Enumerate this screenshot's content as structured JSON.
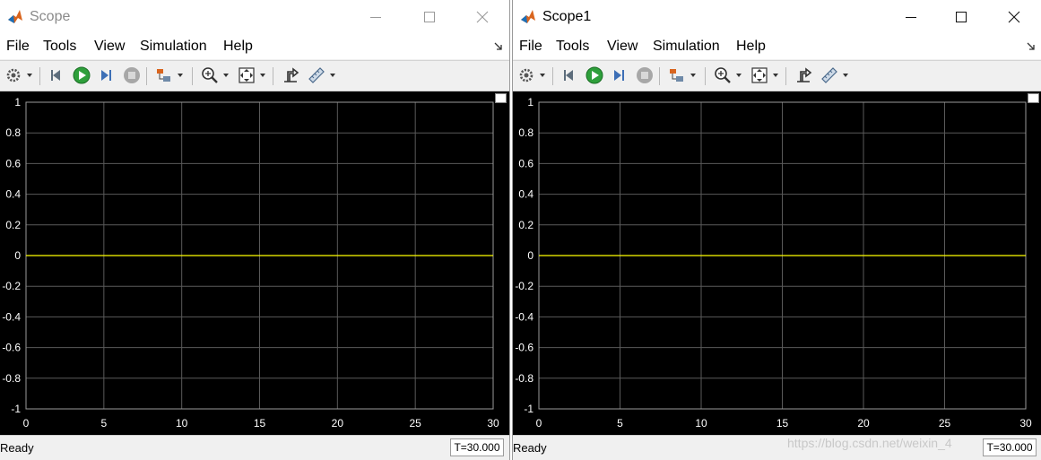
{
  "windows": [
    {
      "title": "Scope",
      "menu": [
        "File",
        "Tools",
        "View",
        "Simulation",
        "Help"
      ],
      "status": "Ready",
      "time": "T=30.000"
    },
    {
      "title": "Scope1",
      "menu": [
        "File",
        "Tools",
        "View",
        "Simulation",
        "Help"
      ],
      "status": "Ready",
      "time": "T=30.000"
    }
  ],
  "toolbar_icons": [
    "settings-icon",
    "step-back-icon",
    "run-icon",
    "step-forward-icon",
    "stop-icon",
    "highlight-block-icon",
    "zoom-in-icon",
    "zoom-fit-icon",
    "cursor-measure-icon",
    "ruler-measure-icon"
  ],
  "watermark": "https://blog.csdn.net/weixin_4",
  "colors": {
    "plot_bg": "#000000",
    "grid": "#5a5a5a",
    "signal": "#ffff00",
    "axis_text": "#ffffff"
  },
  "chart_data": [
    {
      "type": "line",
      "title": "",
      "xlabel": "",
      "ylabel": "",
      "xlim": [
        0,
        30
      ],
      "ylim": [
        -1,
        1
      ],
      "xticks": [
        0,
        5,
        10,
        15,
        20,
        25,
        30
      ],
      "yticks": [
        1,
        0.8,
        0.6,
        0.4,
        0.2,
        0,
        -0.2,
        -0.4,
        -0.6,
        -0.8,
        -1
      ],
      "ytick_labels": [
        "1",
        "0.8",
        "0.6",
        "0.4",
        "0.2",
        "0",
        "-0.2",
        "-0.4",
        "-0.6",
        "-0.8",
        "-1"
      ],
      "grid": true,
      "series": [
        {
          "x": [
            0,
            30
          ],
          "values": [
            0,
            0
          ],
          "color": "#ffff00"
        }
      ]
    },
    {
      "type": "line",
      "title": "",
      "xlabel": "",
      "ylabel": "",
      "xlim": [
        0,
        30
      ],
      "ylim": [
        -1,
        1
      ],
      "xticks": [
        0,
        5,
        10,
        15,
        20,
        25,
        30
      ],
      "yticks": [
        1,
        0.8,
        0.6,
        0.4,
        0.2,
        0,
        -0.2,
        -0.4,
        -0.6,
        -0.8,
        -1
      ],
      "ytick_labels": [
        "1",
        "0.8",
        "0.6",
        "0.4",
        "0.2",
        "0",
        "-0.2",
        "-0.4",
        "-0.6",
        "-0.8",
        "-1"
      ],
      "grid": true,
      "series": [
        {
          "x": [
            0,
            30
          ],
          "values": [
            0,
            0
          ],
          "color": "#ffff00"
        }
      ]
    }
  ]
}
